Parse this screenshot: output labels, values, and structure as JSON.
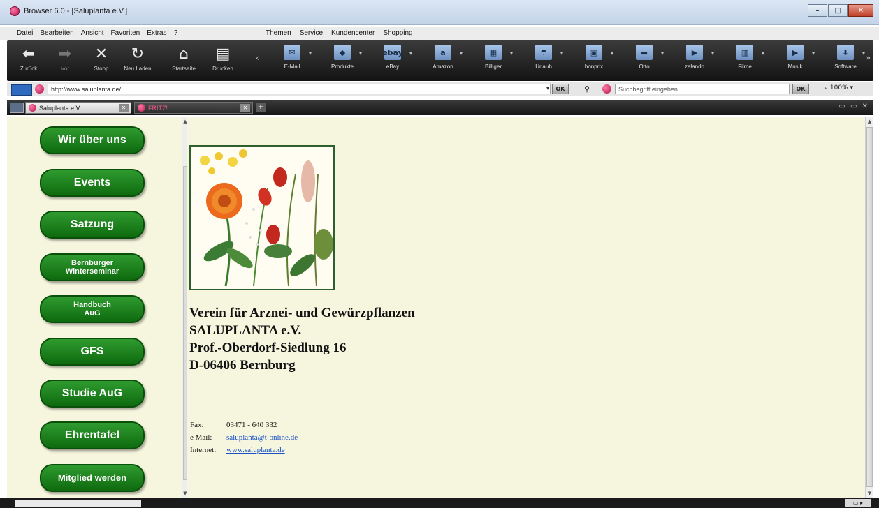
{
  "window": {
    "title": "Browser 6.0 - [Saluplanta e.V.]",
    "controls": [
      "–",
      "□",
      "✕"
    ]
  },
  "menu": {
    "left": [
      "Datei",
      "Bearbeiten",
      "Ansicht",
      "Favoriten",
      "Extras",
      "?"
    ],
    "right": [
      "Themen",
      "Service",
      "Kundencenter",
      "Shopping"
    ]
  },
  "nav": {
    "back": "Zurück",
    "forward": "Vor",
    "stop": "Stopp",
    "reload": "Neu Laden",
    "home": "Startseite",
    "print": "Drucken"
  },
  "quick_links": [
    {
      "label": "E-Mail",
      "icon": "mail-icon",
      "glyph": "✉"
    },
    {
      "label": "Produkte",
      "icon": "products-icon",
      "glyph": "◆"
    },
    {
      "label": "eBay",
      "icon": "ebay-icon",
      "glyph": "ebay"
    },
    {
      "label": "Amazon",
      "icon": "amazon-icon",
      "glyph": "a"
    },
    {
      "label": "Billiger",
      "icon": "billiger-icon",
      "glyph": "▦"
    },
    {
      "label": "Urlaub",
      "icon": "urlaub-icon",
      "glyph": "☂"
    },
    {
      "label": "bonprix",
      "icon": "bonprix-icon",
      "glyph": "▣"
    },
    {
      "label": "Otto",
      "icon": "otto-icon",
      "glyph": "▬"
    },
    {
      "label": "zalando",
      "icon": "zalando-icon",
      "glyph": "▶"
    },
    {
      "label": "Filme",
      "icon": "film-icon",
      "glyph": "▥"
    },
    {
      "label": "Musik",
      "icon": "music-icon",
      "glyph": "▶"
    },
    {
      "label": "Software",
      "icon": "software-icon",
      "glyph": "⬇"
    }
  ],
  "address": {
    "url": "http://www.saluplanta.de/",
    "go": "OK"
  },
  "search": {
    "placeholder": "Suchbegriff eingeben",
    "go": "OK",
    "zoom": "100%"
  },
  "tabs": [
    {
      "title": "Saluplanta e.V."
    },
    {
      "title": "FRITZ!"
    }
  ],
  "sidebar": {
    "buttons": [
      {
        "label": "Wir über uns",
        "size": "big"
      },
      {
        "label": "Events",
        "size": "big"
      },
      {
        "label": "Satzung",
        "size": "big"
      },
      {
        "label": "Bernburger\nWinterseminar",
        "size": "small"
      },
      {
        "label": "Handbuch\nAuG",
        "size": "small"
      },
      {
        "label": "GFS",
        "size": "big"
      },
      {
        "label": "Studie AuG",
        "size": "big"
      },
      {
        "label": "Ehrentafel",
        "size": "big"
      },
      {
        "label": "Mitglied werden",
        "size": "small"
      }
    ]
  },
  "main": {
    "address_lines": [
      "Verein für Arznei- und Gewürzpflanzen",
      "SALUPLANTA e.V.",
      "Prof.-Oberdorf-Siedlung 16",
      "D-06406 Bernburg"
    ],
    "contact": [
      {
        "label": "Fax:",
        "value": "03471 - 640 332",
        "link": false
      },
      {
        "label": "e Mail:",
        "value": "saluplanta@t-online.de",
        "link": true
      },
      {
        "label": "Internet:",
        "value": "www.saluplanta.de",
        "link": true
      }
    ]
  },
  "colors": {
    "page_bg": "#f6f6de",
    "button_green": "#1a7f1a",
    "link": "#1a52c7",
    "toolbar_dark": "#1e1e1e"
  }
}
